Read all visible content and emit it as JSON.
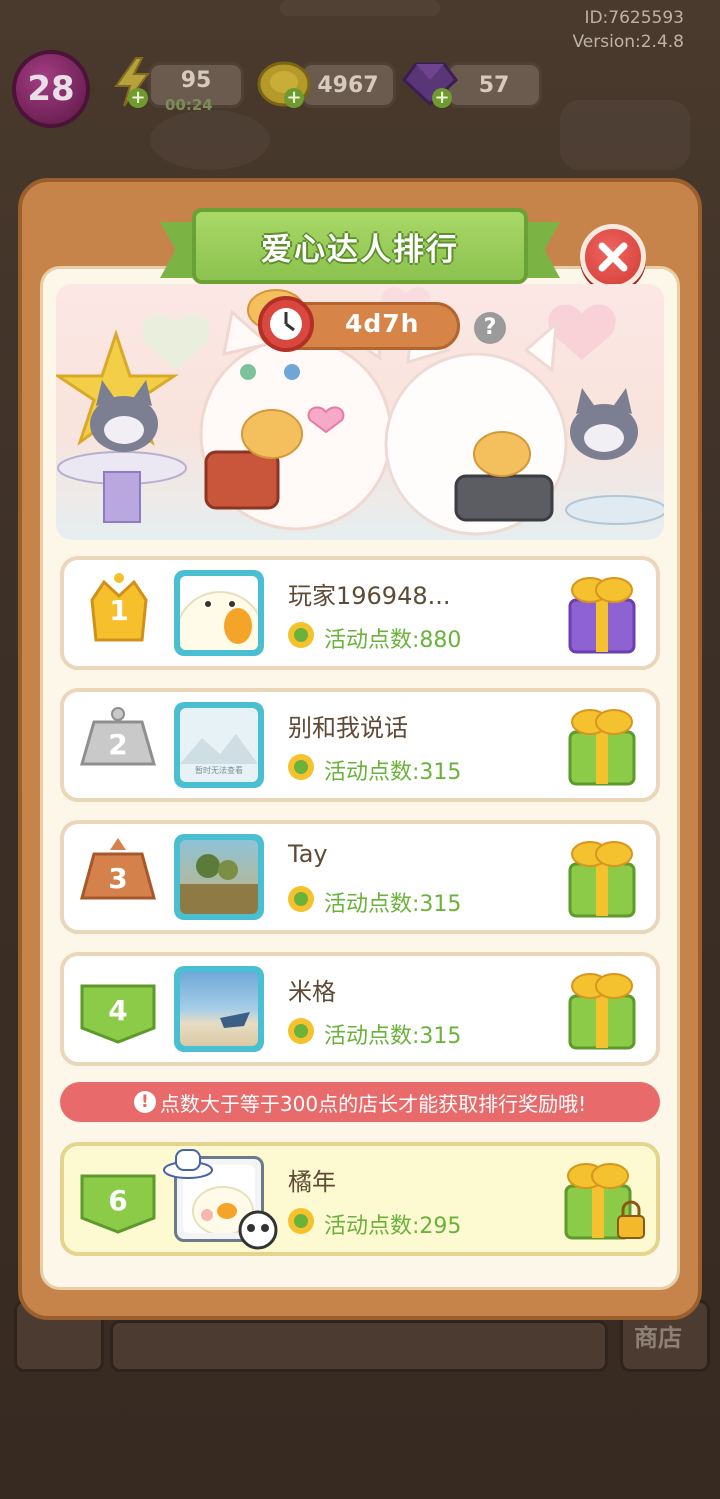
{
  "version": {
    "id": "ID:7625593",
    "version": "Version:2.4.8"
  },
  "hud": {
    "level": "28",
    "energy": "95",
    "energy_timer": "00:24",
    "coins": "4967",
    "gems": "57"
  },
  "popup": {
    "title": "爱心达人排行",
    "countdown": "4d7h",
    "help": "?"
  },
  "ranking": {
    "rows": [
      {
        "rank": "1",
        "name": "玩家196948...",
        "points": "活动点数:880"
      },
      {
        "rank": "2",
        "name": "别和我说话",
        "points": "活动点数:315"
      },
      {
        "rank": "3",
        "name": "Tay",
        "points": "活动点数:315"
      },
      {
        "rank": "4",
        "name": "米格",
        "points": "活动点数:315"
      }
    ],
    "notice": "点数大于等于300点的店长才能获取排行奖励哦!",
    "me": {
      "rank": "6",
      "name": "橘年",
      "points": "活动点数:295"
    },
    "placeholder_avatar_text": "暂时无法查看"
  },
  "bottom": {
    "shop": "商店"
  },
  "colors": {
    "panel": "#c6834a",
    "ribbon": "#8cc24f",
    "points": "#6ab23a",
    "notice": "#e86a6a",
    "avatar_frame": "#49bfd1"
  }
}
